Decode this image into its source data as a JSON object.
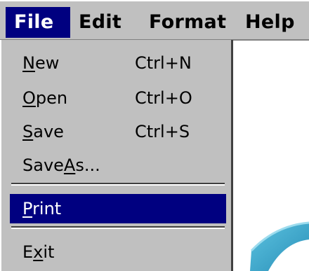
{
  "menubar": {
    "items": [
      {
        "label": "File",
        "active": true
      },
      {
        "label": "Edit",
        "active": false
      },
      {
        "label": "Format",
        "active": false
      },
      {
        "label": "Help",
        "active": false
      }
    ]
  },
  "file_menu": {
    "items": [
      {
        "label_pre": "",
        "label_ul": "N",
        "label_post": "ew",
        "shortcut": "Ctrl+N"
      },
      {
        "label_pre": "",
        "label_ul": "O",
        "label_post": "pen",
        "shortcut": "Ctrl+O"
      },
      {
        "label_pre": "",
        "label_ul": "S",
        "label_post": "ave",
        "shortcut": "Ctrl+S"
      },
      {
        "label_pre": "Save",
        "label_ul": "A",
        "label_post": "s...",
        "shortcut": ""
      },
      {
        "label_pre": "",
        "label_ul": "P",
        "label_post": "rint",
        "shortcut": "",
        "selected": true
      },
      {
        "label_pre": "E",
        "label_ul": "x",
        "label_post": "it",
        "shortcut": ""
      }
    ]
  },
  "colors": {
    "menu_background": "#c0c0c0",
    "highlight": "#000080",
    "highlight_text": "#ffffff",
    "arrow_teal": "#3aa6c8"
  },
  "icons": {
    "decoration": "curved-arrow-icon"
  }
}
